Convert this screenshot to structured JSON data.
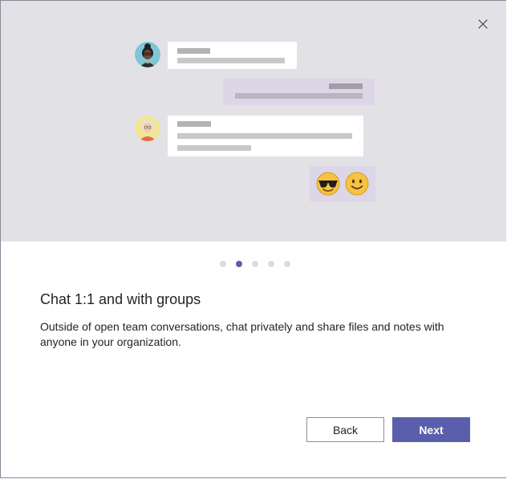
{
  "dialog": {
    "close_icon": "close-icon",
    "carousel": {
      "total_steps": 5,
      "active_step": 2
    },
    "title": "Chat 1:1 and with groups",
    "description": "Outside of open team conversations, chat privately and share files and notes with anyone in your organization.",
    "buttons": {
      "back_label": "Back",
      "next_label": "Next"
    },
    "illustration": {
      "emojis": [
        "sunglasses-emoji-icon",
        "smiley-emoji-icon"
      ]
    },
    "colors": {
      "accent": "#5b5fab",
      "hero_background": "#e2e1e6",
      "own_message_bubble": "#ddd6e7"
    }
  }
}
